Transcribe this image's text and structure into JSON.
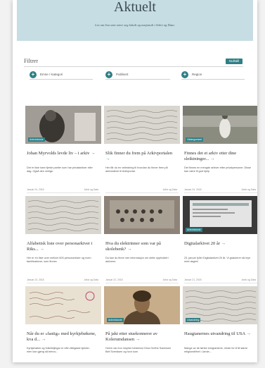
{
  "hero": {
    "title": "Aktuelt",
    "subtitle": "Les om hva som rører seg lokalt og nasjonalt i Arkiv og Data."
  },
  "filters": {
    "title": "Filtrer",
    "reset_label": "Nullstill",
    "items": [
      {
        "label": "Emne / Kategori"
      },
      {
        "label": "Publisert"
      },
      {
        "label": "Region"
      }
    ]
  },
  "theme": {
    "accent": "#2f7f86",
    "hero_bg": "#c6dde3"
  },
  "cards": [
    {
      "badge": "Arkivhistorie",
      "title": "Johan Myrvolds levde liv – i arkiv",
      "desc": "Det er ikke bare fjerde partier som har privatarkiver eller dag. Også den verlige.",
      "date": "Januar 24, 2018",
      "author": "Arkiv og Data",
      "style": "photo-dark"
    },
    {
      "badge": "",
      "title": "Slik finner du frem på Arkivportalen",
      "desc": "Her får du en veiledning til hvordan du finner frem på arkivsidene til Arkivportal.",
      "date": "",
      "author": "Arkiv og Data",
      "style": "script"
    },
    {
      "badge": "Ukategorisert",
      "title": "Finnes det et arkiv etter dine sleiktninger...",
      "desc": "Det finnes en mengde arkiver etter privatpersoner. Disse kan være til god hjelp",
      "date": "Januar 24, 2018",
      "author": "Arkiv og Data",
      "style": "photo-light"
    },
    {
      "badge": "",
      "title": "Alfabetisk liste over personarkiver i Riks...",
      "desc": "Her er en liste over mellom 600 personarkiver og noen familiearkiver, som finnes",
      "date": "Januar 23, 2018",
      "author": "Arkiv og Data",
      "style": "script"
    },
    {
      "badge": "",
      "title": "Hva du elektrinner som var på skolebenk?",
      "desc": "Du kan du finne mer informasjon om dette oppholdet i arkivene.",
      "date": "Januar 22, 2018",
      "author": "Arkiv og Data",
      "style": "photo-group"
    },
    {
      "badge": "Arkivhistorie",
      "title": "Digitalarkivet 20 år",
      "desc": "23. januar fyller Digitalarkivet 20 år. Vi gratulerer så mye med dagen!",
      "date": "Januar 21, 2018",
      "author": "Arkiv og Data",
      "style": "photo-screen"
    },
    {
      "badge": "",
      "title": "Når du er «fastig» med kyrkjebøkene, kva d...",
      "desc": "Kyrkjebøker og folketeljingar er ofte viktigaste kjelder. men kan gjeng så behov...",
      "date": "",
      "author": "",
      "style": "letter"
    },
    {
      "badge": "Arkivhistorie",
      "title": "På jakt etter stuekonnerer av Kolerumdansen",
      "desc": "Hvem var mor inspirer bestemor Dina Grethe Sørensen Bell Svendsen og hvor kom",
      "date": "",
      "author": "",
      "style": "portrait"
    },
    {
      "badge": "Utvandring",
      "title": "Haugianernes utvandring til USA",
      "desc": "Mange av de første emigrantene, reiste for å få større religionsfrihet i Jamie...",
      "date": "",
      "author": "",
      "style": "script"
    }
  ]
}
